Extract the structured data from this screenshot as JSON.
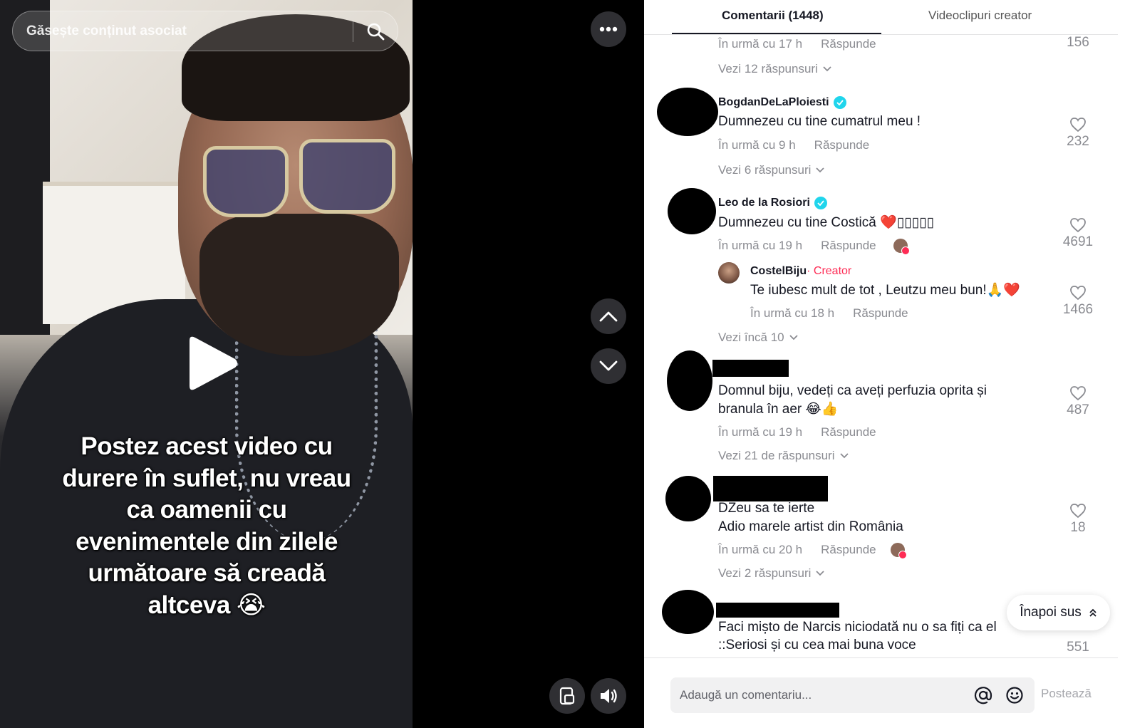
{
  "search": {
    "placeholder": "Găsește conținut asociat"
  },
  "video": {
    "caption_lines": [
      "Postez acest video cu",
      "durere în suflet, nu vreau",
      "ca oamenii cu",
      "evenimentele din zilele",
      "următoare să creadă",
      "altceva 😭"
    ]
  },
  "tabs": {
    "comments": "Comentarii (1448)",
    "creator_videos": "Videoclipuri creator"
  },
  "comments": [
    {
      "time": "În urmă cu 17 h",
      "reply": "Răspunde",
      "likes": "156",
      "more": "Vezi 12 răspunsuri"
    },
    {
      "user": "BogdanDeLaPloiesti",
      "text": "Dumnezeu cu tine cumatrul meu !",
      "time": "În urmă cu 9 h",
      "reply": "Răspunde",
      "likes": "232",
      "more": "Vezi 6 răspunsuri"
    },
    {
      "user": "Leo de la Rosiori",
      "text": "Dumnezeu cu tine Costică ❤️▯▯▯▯▯",
      "time": "În urmă cu 19 h",
      "reply": "Răspunde",
      "likes": "4691",
      "sub": {
        "user": "CostelBiju",
        "tag": " · Creator",
        "text": "Te iubesc mult de tot , Leutzu meu bun!🙏❤️",
        "time": "În urmă cu 18 h",
        "reply": "Răspunde",
        "likes": "1466"
      },
      "more": "Vezi încă 10"
    },
    {
      "text1": "Domnul biju, vedeți ca aveți perfuzia oprita și",
      "text2": "branula în aer 😂👍",
      "time": "În urmă cu 19 h",
      "reply": "Răspunde",
      "likes": "487",
      "more": "Vezi 21 de răspunsuri"
    },
    {
      "text1": "DZeu sa te ierte",
      "text2": "Adio marele artist din România",
      "time": "În urmă cu 20 h",
      "reply": "Răspunde",
      "likes": "18",
      "more": "Vezi 2 răspunsuri"
    },
    {
      "text1": "Faci mișto de Narcis niciodată nu o sa fiți ca el",
      "text2": "::Seriosi și cu cea mai buna voce",
      "likes": "551"
    }
  ],
  "back_to_top": "Înapoi sus",
  "composer": {
    "placeholder": "Adaugă un comentariu...",
    "post": "Postează"
  }
}
